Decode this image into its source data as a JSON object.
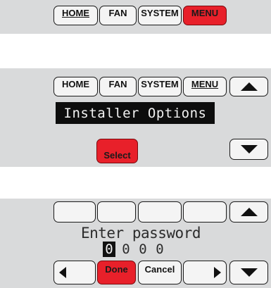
{
  "panel1": {
    "tabs": [
      {
        "label": "HOME",
        "underline": true,
        "active": false
      },
      {
        "label": "FAN",
        "underline": false,
        "active": false
      },
      {
        "label": "SYSTEM",
        "underline": false,
        "active": false
      },
      {
        "label": "MENU",
        "underline": false,
        "active": true
      }
    ]
  },
  "panel2": {
    "tabs": [
      {
        "label": "HOME",
        "underline": false
      },
      {
        "label": "FAN",
        "underline": false
      },
      {
        "label": "SYSTEM",
        "underline": false
      },
      {
        "label": "MENU",
        "underline": true
      }
    ],
    "title": "Installer Options",
    "select_label": "Select",
    "up_icon": "triangle-up-icon",
    "down_icon": "triangle-down-icon"
  },
  "panel3": {
    "prompt": "Enter password",
    "digits": [
      "0",
      "0",
      "0",
      "0"
    ],
    "selected_digit": 0,
    "done_label": "Done",
    "cancel_label": "Cancel",
    "icons": [
      "triangle-up-icon",
      "arrow-left-icon",
      "arrow-right-icon",
      "triangle-down-icon"
    ]
  },
  "colors": {
    "panel_bg": "#d9dadb",
    "button_bg": "#f4f4f4",
    "accent_red": "#e8202a",
    "banner_bg": "#0d0d0d"
  }
}
